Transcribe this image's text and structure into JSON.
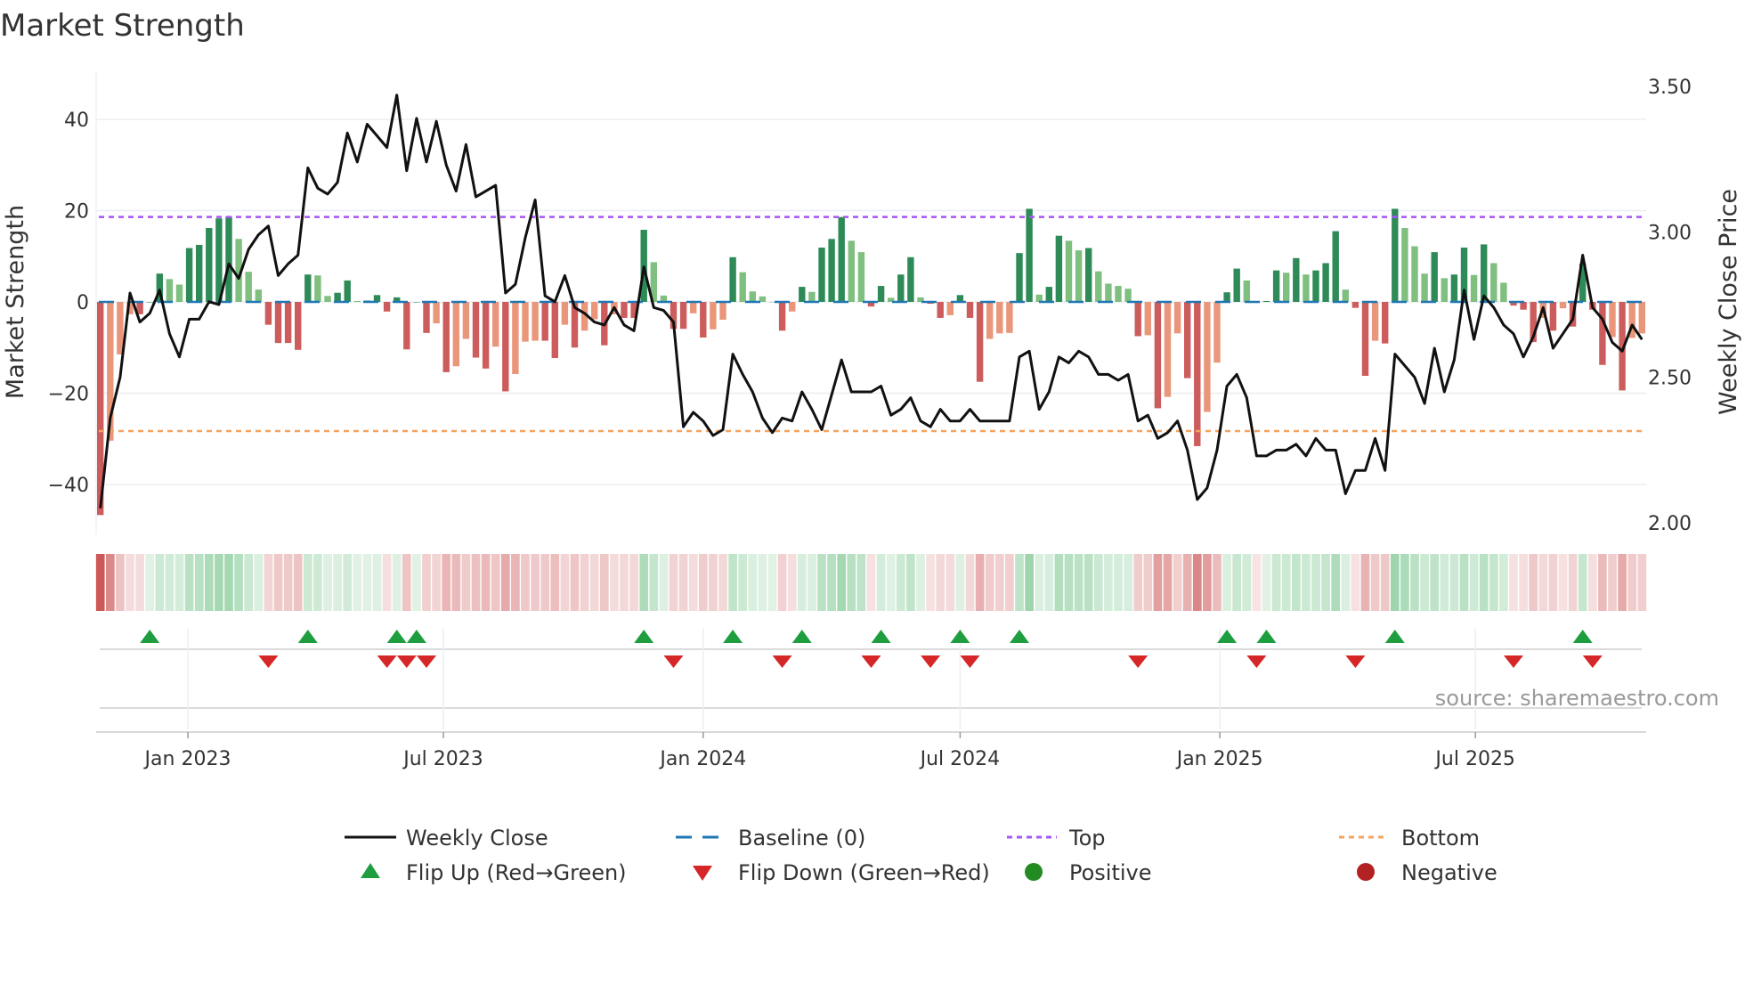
{
  "title": "Market Strength",
  "source": "source: sharemaestro.com",
  "colors": {
    "pos_strong": "#2e8b57",
    "pos_weak": "#7fbf7f",
    "neg_strong": "#cd5c5c",
    "neg_weak": "#e9967a",
    "line": "#111111",
    "baseline": "#1f77b4",
    "top": "#a855f7",
    "bottom": "#f4a460",
    "flip_up": "#1e9e3e",
    "flip_down": "#d62728",
    "positive": "#228b22",
    "negative": "#b22222"
  },
  "legend": {
    "weekly_close": "Weekly Close",
    "baseline": "Baseline (0)",
    "top": "Top",
    "bottom": "Bottom",
    "flip_up": "Flip Up (Red→Green)",
    "flip_down": "Flip Down (Green→Red)",
    "positive": "Positive",
    "negative": "Negative"
  },
  "chart_data": {
    "type": "bar+line",
    "title": "Market Strength",
    "ylabel": "Market Strength",
    "y2label": "Weekly Close Price",
    "ylim": [
      -50,
      50
    ],
    "y2lim": [
      1.95,
      3.6
    ],
    "yticks": [
      {
        "v": 40,
        "label": "40"
      },
      {
        "v": 20,
        "label": "20"
      },
      {
        "v": 0,
        "label": "0"
      },
      {
        "v": -20,
        "label": "−20"
      },
      {
        "v": -40,
        "label": "−40"
      }
    ],
    "y2ticks": [
      {
        "v": 3.5,
        "label": "3.50"
      },
      {
        "v": 3.0,
        "label": "3.00"
      },
      {
        "v": 2.5,
        "label": "2.50"
      },
      {
        "v": 2.0,
        "label": "2.00"
      }
    ],
    "xticks": [
      {
        "date": "2023-01-01",
        "label": "Jan 2023"
      },
      {
        "date": "2023-07-01",
        "label": "Jul 2023"
      },
      {
        "date": "2024-01-01",
        "label": "Jan 2024"
      },
      {
        "date": "2024-07-01",
        "label": "Jul 2024"
      },
      {
        "date": "2025-01-01",
        "label": "Jan 2025"
      },
      {
        "date": "2025-07-01",
        "label": "Jul 2025"
      }
    ],
    "start_date": "2022-10-31",
    "interval": "weekly",
    "top_level": 18.6,
    "bottom_level": -28.3,
    "baseline": 0,
    "strength": [
      -46.7,
      -30.4,
      -11.5,
      -2.7,
      -2.7,
      0,
      6.2,
      5.0,
      3.8,
      11.8,
      12.5,
      16.2,
      18.3,
      18.7,
      13.8,
      6.6,
      2.7,
      -5.0,
      -9.0,
      -9.0,
      -10.5,
      6.0,
      5.8,
      1.3,
      2.0,
      4.7,
      0.2,
      0.3,
      1.5,
      -2.1,
      1.0,
      -10.4,
      0,
      -6.8,
      -4.7,
      -15.4,
      -14.1,
      -8.1,
      -12.2,
      -14.6,
      -9.8,
      -19.6,
      -15.8,
      -8.7,
      -8.5,
      -8.5,
      -12.3,
      -5.0,
      -10.0,
      -6.3,
      -3.8,
      -9.5,
      -2.7,
      -3.5,
      -3.5,
      15.8,
      8.7,
      1.4,
      -5.9,
      -5.9,
      -2.5,
      -7.8,
      -6.0,
      -3.9,
      9.8,
      6.5,
      2.3,
      1.2,
      0,
      -6.3,
      -2.1,
      3.3,
      2.2,
      11.9,
      13.8,
      18.6,
      13.4,
      10.9,
      -1.0,
      3.5,
      0.9,
      6.0,
      9.8,
      1.0,
      -0.4,
      -3.5,
      -2.9,
      1.5,
      -3.5,
      -17.5,
      -8.1,
      -6.9,
      -6.8,
      10.7,
      20.4,
      1.6,
      3.3,
      14.5,
      13.4,
      11.3,
      11.8,
      6.7,
      4.0,
      3.5,
      2.9,
      -7.5,
      -7.3,
      -23.3,
      -20.8,
      -6.9,
      -16.7,
      -31.6,
      -24.1,
      -13.3,
      2.1,
      7.3,
      4.7,
      -0.2,
      0.2,
      6.9,
      6.4,
      9.6,
      6.0,
      6.9,
      8.5,
      15.5,
      2.7,
      -1.3,
      -16.2,
      -8.5,
      -9.1,
      20.4,
      16.2,
      12.2,
      6.2,
      10.9,
      5.2,
      6.0,
      11.9,
      5.9,
      12.6,
      8.5,
      4.2,
      -0.8,
      -1.7,
      -8.8,
      -3.5,
      -6.3,
      -1.4,
      -5.4,
      8.4,
      -1.7,
      -13.8,
      -7.7,
      -19.4,
      -7.9,
      -6.9
    ],
    "weekly_close": [
      2.05,
      2.36,
      2.5,
      2.79,
      2.69,
      2.72,
      2.8,
      2.65,
      2.57,
      2.7,
      2.7,
      2.76,
      2.75,
      2.89,
      2.84,
      2.94,
      2.99,
      3.02,
      2.85,
      2.89,
      2.92,
      3.22,
      3.15,
      3.13,
      3.17,
      3.34,
      3.24,
      3.37,
      3.33,
      3.29,
      3.47,
      3.21,
      3.39,
      3.24,
      3.38,
      3.23,
      3.14,
      3.3,
      3.12,
      3.14,
      3.16,
      2.79,
      2.82,
      2.98,
      3.11,
      2.78,
      2.76,
      2.85,
      2.74,
      2.72,
      2.69,
      2.68,
      2.74,
      2.68,
      2.66,
      2.88,
      2.74,
      2.73,
      2.69,
      2.33,
      2.38,
      2.35,
      2.3,
      2.32,
      2.58,
      2.51,
      2.45,
      2.36,
      2.31,
      2.36,
      2.35,
      2.45,
      2.39,
      2.32,
      2.44,
      2.56,
      2.45,
      2.45,
      2.45,
      2.47,
      2.37,
      2.39,
      2.43,
      2.35,
      2.33,
      2.39,
      2.35,
      2.35,
      2.39,
      2.35,
      2.35,
      2.35,
      2.35,
      2.57,
      2.59,
      2.39,
      2.45,
      2.57,
      2.55,
      2.59,
      2.57,
      2.51,
      2.51,
      2.49,
      2.51,
      2.35,
      2.37,
      2.29,
      2.31,
      2.35,
      2.25,
      2.08,
      2.12,
      2.25,
      2.47,
      2.51,
      2.43,
      2.23,
      2.23,
      2.25,
      2.25,
      2.27,
      2.23,
      2.29,
      2.25,
      2.25,
      2.1,
      2.18,
      2.18,
      2.29,
      2.18,
      2.58,
      2.54,
      2.5,
      2.41,
      2.6,
      2.45,
      2.56,
      2.8,
      2.63,
      2.78,
      2.74,
      2.68,
      2.65,
      2.57,
      2.64,
      2.74,
      2.6,
      2.65,
      2.7,
      2.92,
      2.74,
      2.7,
      2.62,
      2.59,
      2.68,
      2.63
    ],
    "legend_position": "bottom"
  }
}
